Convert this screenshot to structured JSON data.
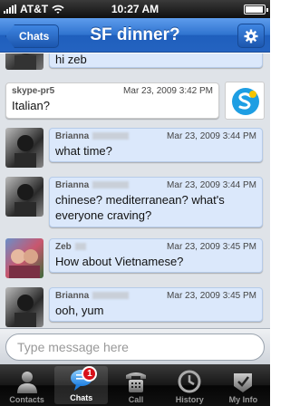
{
  "status_bar": {
    "carrier": "AT&T",
    "time": "10:27 AM"
  },
  "nav": {
    "back_label": "Chats",
    "title": "SF dinner?",
    "settings_icon": "gear-icon"
  },
  "messages": [
    {
      "sender": "",
      "time": "",
      "text": "hi zeb",
      "style": "blue",
      "avatar": "bw-portrait"
    },
    {
      "sender": "skype-pr5",
      "time": "Mar 23, 2009 3:42 PM",
      "text": "Italian?",
      "style": "white",
      "avatar": "skype-logo"
    },
    {
      "sender": "Brianna",
      "time": "Mar 23, 2009 3:44 PM",
      "text": "what time?",
      "style": "blue",
      "avatar": "bw-portrait"
    },
    {
      "sender": "Brianna",
      "time": "Mar 23, 2009 3:44 PM",
      "text": "chinese? mediterranean? what's everyone craving?",
      "style": "blue",
      "avatar": "bw-portrait"
    },
    {
      "sender": "Zeb",
      "time": "Mar 23, 2009 3:45 PM",
      "text": "How about Vietnamese?",
      "style": "blue",
      "avatar": "color-couple"
    },
    {
      "sender": "Brianna",
      "time": "Mar 23, 2009 3:45 PM",
      "text": "ooh, yum",
      "style": "blue",
      "avatar": "bw-portrait"
    }
  ],
  "compose": {
    "placeholder": "Type message here"
  },
  "tabs": [
    {
      "label": "Contacts",
      "icon": "person-icon",
      "active": false
    },
    {
      "label": "Chats",
      "icon": "chat-bubble-icon",
      "active": true,
      "badge": "1"
    },
    {
      "label": "Call",
      "icon": "phone-icon",
      "active": false
    },
    {
      "label": "History",
      "icon": "clock-icon",
      "active": false
    },
    {
      "label": "My Info",
      "icon": "info-card-icon",
      "active": false
    }
  ],
  "colors": {
    "nav_blue": "#2f73cf",
    "bubble_blue": "#dbe8fb",
    "badge_red": "#d8111b"
  }
}
